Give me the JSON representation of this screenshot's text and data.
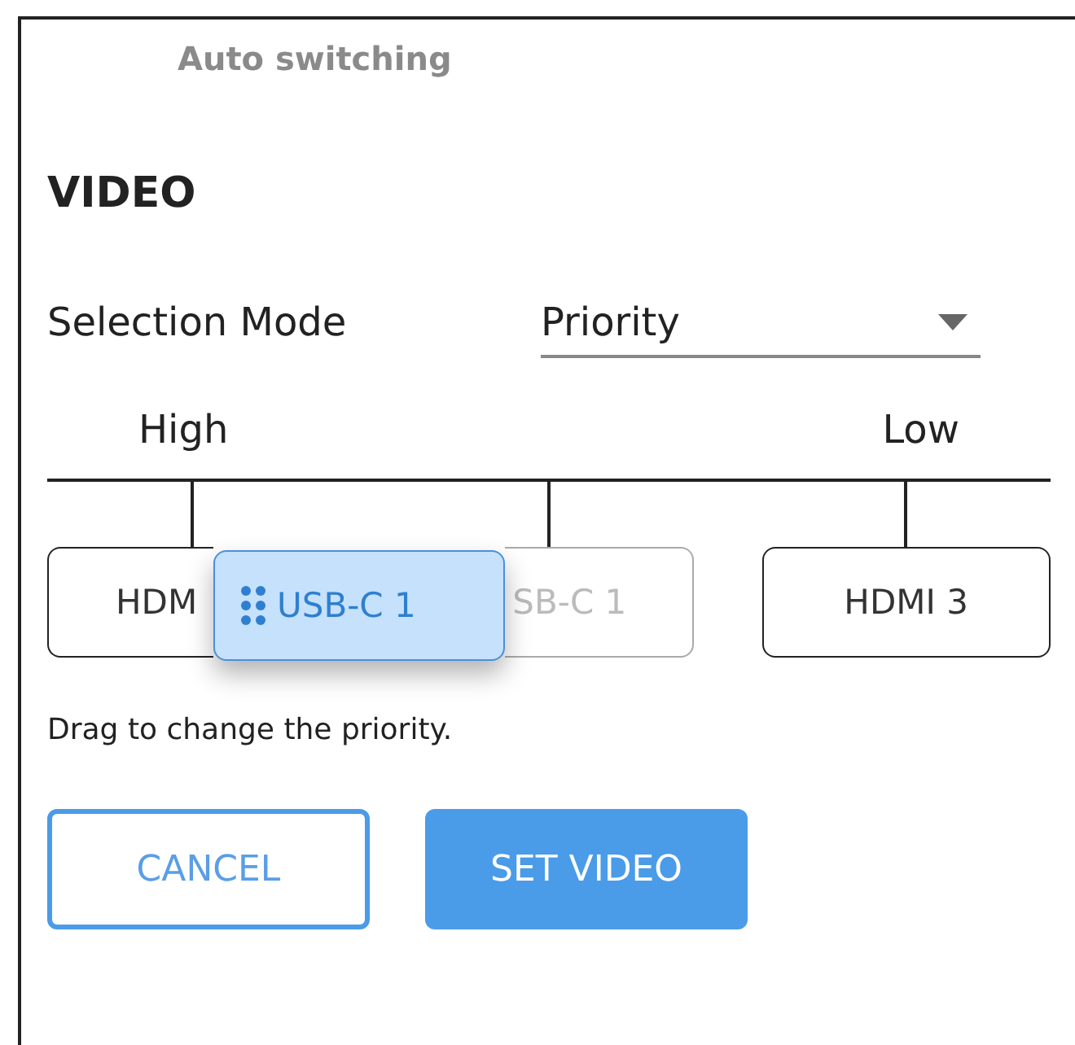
{
  "tab": {
    "label": "Auto switching"
  },
  "section": {
    "title": "VIDEO"
  },
  "selection_mode": {
    "label": "Selection Mode",
    "value": "Priority"
  },
  "priority": {
    "high_label": "High",
    "low_label": "Low",
    "items": [
      {
        "label": "HDM",
        "kind": "slot"
      },
      {
        "label": "SB-C 1",
        "kind": "placeholder"
      },
      {
        "label": "HDMI 3",
        "kind": "slot"
      }
    ],
    "dragging": {
      "label": "USB-C 1"
    }
  },
  "hint": "Drag to change the priority.",
  "buttons": [
    {
      "label": "CANCEL",
      "kind": "outline"
    },
    {
      "label": "SET VIDEO",
      "kind": "filled"
    }
  ]
}
